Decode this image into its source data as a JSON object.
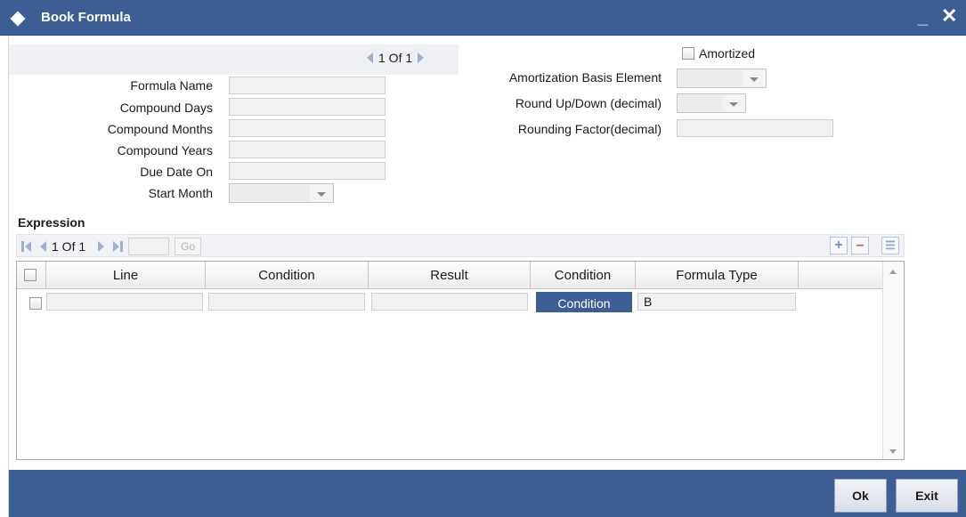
{
  "window": {
    "title": "Book Formula",
    "minimize_glyph": "_",
    "close_glyph": "✕",
    "icon": "diamond-icon"
  },
  "top_pager": {
    "text": "1 Of 1"
  },
  "form_left": {
    "formula_name_label": "Formula Name",
    "compound_days_label": "Compound Days",
    "compound_months_label": "Compound Months",
    "compound_years_label": "Compound Years",
    "due_date_on_label": "Due Date On",
    "start_month_label": "Start Month"
  },
  "form_right": {
    "amortized_label": "Amortized",
    "amortization_basis_label": "Amortization Basis Element",
    "round_up_down_label": "Round Up/Down (decimal)",
    "rounding_factor_label": "Rounding Factor(decimal)"
  },
  "expression": {
    "title": "Expression",
    "pager_text": "1 Of 1",
    "go_label": "Go",
    "add_glyph": "+",
    "remove_glyph": "–",
    "view_glyph": "☰",
    "columns": [
      "Line",
      "Condition",
      "Result",
      "Condition",
      "Formula Type"
    ],
    "rows": [
      {
        "line": "",
        "condition": "",
        "result": "",
        "condition_button": "Condition",
        "formula_type": "B"
      }
    ]
  },
  "footer": {
    "ok_label": "Ok",
    "exit_label": "Exit"
  },
  "colors": {
    "titlebar": "#3d5e94",
    "footer": "#3d5e94",
    "field_bg": "#f1f1f1"
  }
}
